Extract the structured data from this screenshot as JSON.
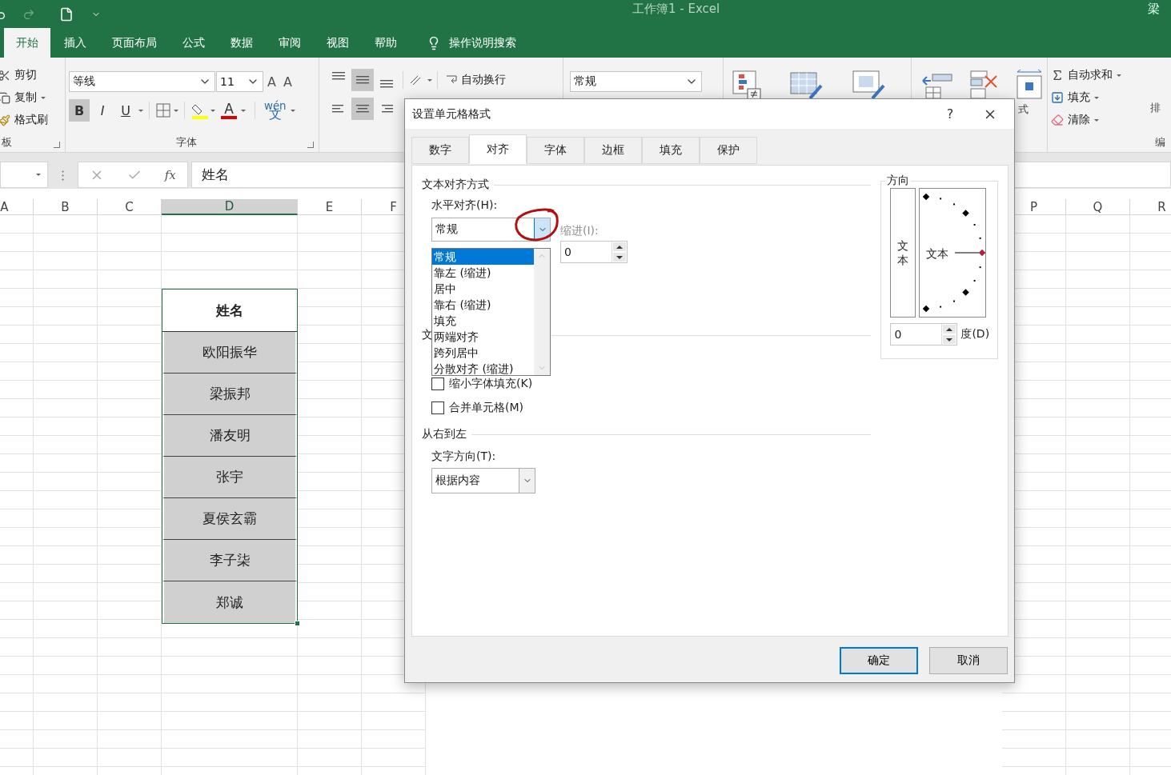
{
  "title_bar": {
    "title": "工作簿1  -  Excel",
    "user": "梁"
  },
  "ribbon_tabs": [
    {
      "label": "开始",
      "selected": true
    },
    {
      "label": "插入",
      "selected": false
    },
    {
      "label": "页面布局",
      "selected": false
    },
    {
      "label": "公式",
      "selected": false
    },
    {
      "label": "数据",
      "selected": false
    },
    {
      "label": "审阅",
      "selected": false
    },
    {
      "label": "视图",
      "selected": false
    },
    {
      "label": "帮助",
      "selected": false
    }
  ],
  "tell_me": "操作说明搜索",
  "clipboard": {
    "cut": "剪切",
    "copy": "复制",
    "format_painter": "格式刷",
    "group_label": "板"
  },
  "font": {
    "name": "等线",
    "size": "11",
    "grow": "A",
    "shrink": "A",
    "bold": {
      "label": "B",
      "on": true
    },
    "italic": {
      "label": "I",
      "on": false
    },
    "underline": {
      "label": "U",
      "on": false
    },
    "font_color": "A",
    "phonetic_top": "wén",
    "phonetic_bottom": "文",
    "group_label": "字体"
  },
  "alignment": {
    "vertical": [
      {
        "kind": "top",
        "on": false
      },
      {
        "kind": "middle",
        "on": true
      },
      {
        "kind": "bottom",
        "on": false
      }
    ],
    "horizontal": [
      {
        "kind": "left",
        "on": false
      },
      {
        "kind": "center",
        "on": true
      },
      {
        "kind": "right",
        "on": false
      }
    ],
    "wrap_text": "自动换行"
  },
  "number": {
    "format": "常规"
  },
  "cells": {
    "format_fragment": "式"
  },
  "editing": {
    "autosum": "自动求和",
    "fill": "填充",
    "clear": "清除",
    "sort": "排",
    "group_label": "编"
  },
  "formula_bar": {
    "function_button": "fx",
    "formula": "姓名"
  },
  "sheet": {
    "columns": [
      {
        "label": "A",
        "selected": false
      },
      {
        "label": "B",
        "selected": false
      },
      {
        "label": "C",
        "selected": false
      },
      {
        "label": "D",
        "selected": true
      },
      {
        "label": "E",
        "selected": false
      },
      {
        "label": "F",
        "selected": false
      },
      {
        "label": "P",
        "selected": false
      },
      {
        "label": "Q",
        "selected": false
      },
      {
        "label": "R",
        "selected": false
      }
    ],
    "table": {
      "header": "姓名",
      "rows": [
        "欧阳振华",
        "梁振邦",
        "潘友明",
        "张宇",
        "夏侯玄霸",
        "李子柒",
        "郑诚"
      ]
    }
  },
  "dialog": {
    "title": "设置单元格格式",
    "help": "?",
    "tabs": [
      {
        "label": "数字",
        "selected": false
      },
      {
        "label": "对齐",
        "selected": true
      },
      {
        "label": "字体",
        "selected": false
      },
      {
        "label": "边框",
        "selected": false
      },
      {
        "label": "填充",
        "selected": false
      },
      {
        "label": "保护",
        "selected": false
      }
    ],
    "text_alignment_heading": "文本对齐方式",
    "horizontal_label": "水平对齐(H):",
    "horizontal_value": "常规",
    "horizontal_options": [
      {
        "label": "常规",
        "selected": true
      },
      {
        "label": "靠左 (缩进)",
        "selected": false
      },
      {
        "label": "居中",
        "selected": false
      },
      {
        "label": "靠右 (缩进)",
        "selected": false
      },
      {
        "label": "填充",
        "selected": false
      },
      {
        "label": "两端对齐",
        "selected": false
      },
      {
        "label": "跨列居中",
        "selected": false
      },
      {
        "label": "分散对齐 (缩进)",
        "selected": false
      }
    ],
    "indent_label": "缩进(I):",
    "indent_value": "0",
    "text_control_heading": "文",
    "checkboxes": [
      {
        "label": "缩小字体填充(K)",
        "checked": false
      },
      {
        "label": "合并单元格(M)",
        "checked": false
      }
    ],
    "rtl_heading": "从右到左",
    "direction_label": "文字方向(T):",
    "direction_value": "根据内容",
    "orientation": {
      "heading": "方向",
      "vertical_text": "文本",
      "dial_text": "文本",
      "degrees": "0",
      "degrees_label": "度(D)"
    },
    "buttons": [
      "确定",
      "取消"
    ]
  }
}
